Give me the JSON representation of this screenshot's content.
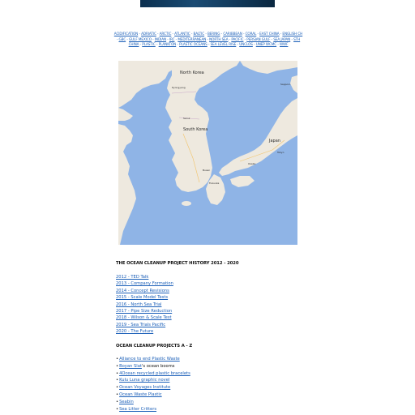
{
  "nav_links": [
    "ACIDIFICATION",
    "ADRIATIC",
    "ARCTIC",
    "ATLANTIC",
    "BALTIC",
    "BERING",
    "CARIBBEAN",
    "CORAL",
    "EAST CHINA",
    "ENGLISH CH",
    "GBC",
    "GULF MEXICO",
    "INDIAN",
    "IRC",
    "MEDITERRANEAN",
    "NORTH SEA",
    "PACIFIC",
    "PERSIAN GULF",
    "SEA JAPAN",
    "STH CHINA",
    "PLASTIC",
    "PLANKTON",
    "PLASTIC OCEANS",
    "SEA LEVEL RISE",
    "UNCLOS",
    "UNEP WCMC",
    "WWF"
  ],
  "map": {
    "labels": {
      "north_korea": "North Korea",
      "south_korea": "South Korea",
      "japan": "Japan",
      "city1": "Pyongyang",
      "city2": "Seoul",
      "city3": "Busan",
      "city4": "Osaka",
      "city5": "Tokyo",
      "city6": "Fukuoka",
      "city7": "Sapporo"
    }
  },
  "history": {
    "title": "THE OCEAN CLEANUP PROJECT HISTORY 2012 - 2020",
    "items": [
      "2012 - TED Talk",
      "2013 - Company Formation",
      "2014 - Concept Revisions",
      "2015 - Scale Model Tests",
      "2016 - North Sea Trial",
      "2017 - Pipe Size Reduction",
      "2018 - Wilson & Scale Test",
      "2019 - Sea Trials Pacific",
      "2020 - The Future"
    ]
  },
  "projects": {
    "title": "OCEAN CLEANUP PROJECTS A - Z",
    "items": [
      {
        "link": "Alliance to end Plastic Waste",
        "suffix": ""
      },
      {
        "link": "Boyan Slat",
        "suffix": "'s ocean booms"
      },
      {
        "link": "4Ocean recycled plastic bracelets",
        "suffix": ""
      },
      {
        "link": "Kulu Luna graphic novel",
        "suffix": ""
      },
      {
        "link": "Ocean Voyages Institute",
        "suffix": ""
      },
      {
        "link": "Ocean Waste Plastic",
        "suffix": ""
      },
      {
        "link": "Seabin",
        "suffix": ""
      },
      {
        "link": "Sea Litter Critters",
        "suffix": ""
      }
    ]
  },
  "colors": {
    "link": "#1b5fb8",
    "sea": "#8fb4e6",
    "land": "#eee9df",
    "banner": "#123a5c"
  }
}
